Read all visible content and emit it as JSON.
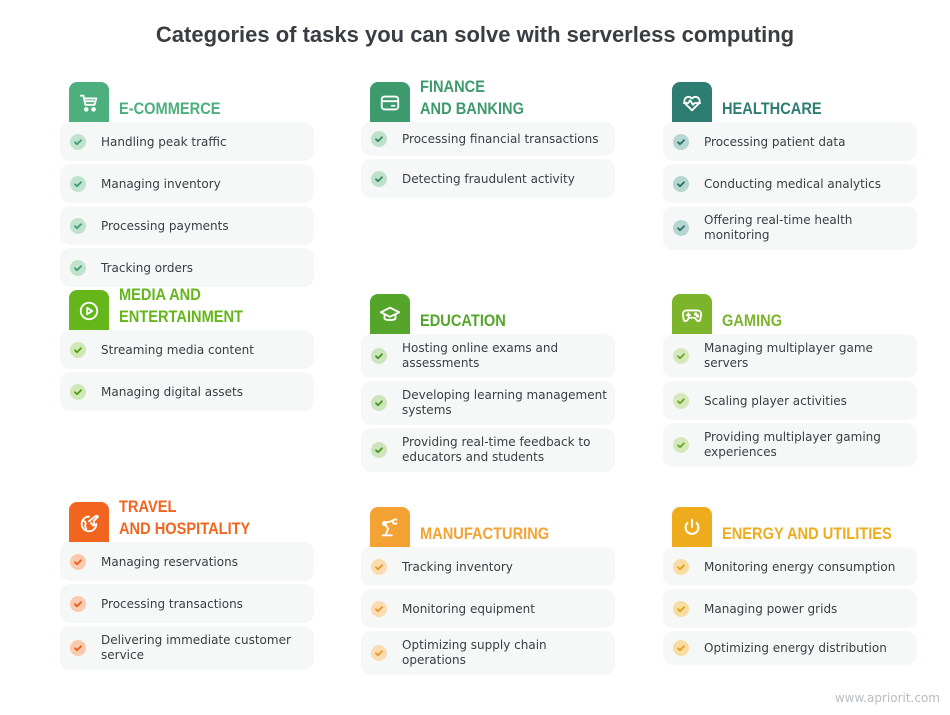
{
  "title": "Categories of tasks you can solve with serverless computing",
  "footer": "www.apriorit.com",
  "categories": [
    {
      "id": "ecommerce",
      "icon": "shopping-cart-icon",
      "color": "#4caf7d",
      "check_bg": "#bfe3cf",
      "check_color": "#3c9d6b",
      "title_lines": [
        "E-COMMERCE"
      ],
      "items": [
        "Handling peak traffic",
        "Managing inventory",
        "Processing payments",
        "Tracking orders"
      ]
    },
    {
      "id": "finance",
      "icon": "credit-card-icon",
      "color": "#3d9a6c",
      "check_bg": "#bfe0cd",
      "check_color": "#2f8a5c",
      "title_lines": [
        "FINANCE",
        "AND BANKING"
      ],
      "items": [
        "Processing financial transactions",
        "Detecting fraudulent activity"
      ]
    },
    {
      "id": "healthcare",
      "icon": "heart-pulse-icon",
      "color": "#2e7d72",
      "check_bg": "#b5d6d1",
      "check_color": "#2a7067",
      "title_lines": [
        "HEALTHCARE"
      ],
      "items": [
        "Processing patient data",
        "Conducting medical analytics",
        "Offering real-time health monitoring"
      ]
    },
    {
      "id": "media",
      "icon": "play-icon",
      "color": "#64b61a",
      "check_bg": "#cfe8b6",
      "check_color": "#4f9d12",
      "title_lines": [
        "MEDIA AND",
        "ENTERTAINMENT"
      ],
      "items": [
        "Streaming media content",
        "Managing digital assets"
      ]
    },
    {
      "id": "education",
      "icon": "graduation-cap-icon",
      "color": "#55a52a",
      "check_bg": "#cde4bd",
      "check_color": "#4a9425",
      "title_lines": [
        "EDUCATION"
      ],
      "items": [
        "Hosting online exams and assessments",
        "Developing learning management systems",
        "Providing real-time feedback to educators and students"
      ]
    },
    {
      "id": "gaming",
      "icon": "gamepad-icon",
      "color": "#7cb52c",
      "check_bg": "#d6e9bb",
      "check_color": "#6ea426",
      "title_lines": [
        "GAMING"
      ],
      "items": [
        "Managing multiplayer game servers",
        "Scaling player activities",
        "Providing multiplayer gaming experiences"
      ]
    },
    {
      "id": "travel",
      "icon": "globe-plane-icon",
      "color": "#f2651e",
      "check_bg": "#fbc9ad",
      "check_color": "#e85a15",
      "title_lines": [
        "TRAVEL",
        "AND HOSPITALITY"
      ],
      "items": [
        "Managing reservations",
        "Processing transactions",
        "Delivering immediate customer service"
      ]
    },
    {
      "id": "manufacturing",
      "icon": "robotic-arm-icon",
      "color": "#f4a233",
      "check_bg": "#fbdcb0",
      "check_color": "#ea9526",
      "title_lines": [
        "MANUFACTURING"
      ],
      "items": [
        "Tracking inventory",
        "Monitoring equipment",
        "Optimizing supply chain operations"
      ]
    },
    {
      "id": "energy",
      "icon": "power-icon",
      "color": "#eeac1c",
      "check_bg": "#f8dca2",
      "check_color": "#e2a012",
      "title_lines": [
        "ENERGY AND UTILITIES"
      ],
      "items": [
        "Monitoring energy consumption",
        "Managing power grids",
        "Optimizing energy distribution"
      ]
    }
  ]
}
